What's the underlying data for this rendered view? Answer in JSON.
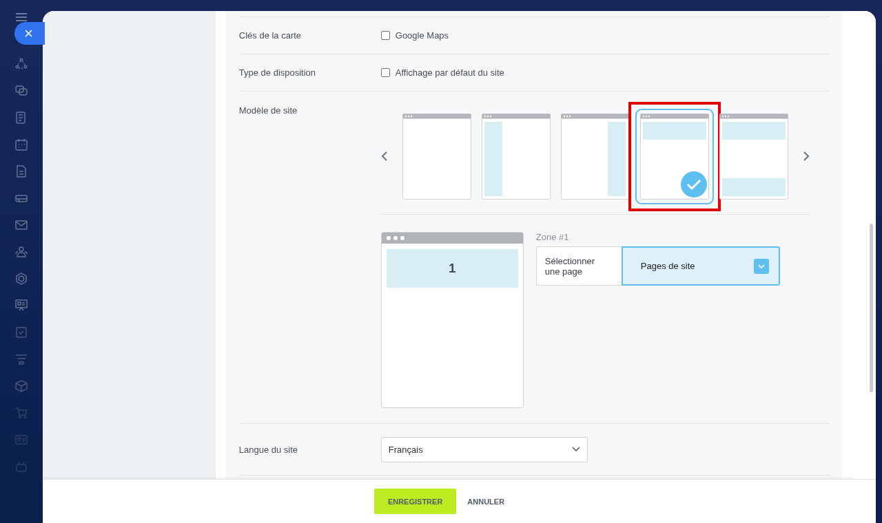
{
  "form": {
    "rows": [
      {
        "kind": "checkbox",
        "label": "Clés de la carte",
        "option": "Google Maps",
        "checked": false
      },
      {
        "kind": "checkbox",
        "label": "Type de disposition",
        "option": "Affichage par défaut du site",
        "checked": false
      },
      {
        "kind": "templates",
        "label": "Modèle de site",
        "templates": [
          {
            "kind": "blank",
            "selected": false
          },
          {
            "kind": "left",
            "selected": false
          },
          {
            "kind": "right",
            "selected": false
          },
          {
            "kind": "top",
            "selected": true
          },
          {
            "kind": "banded",
            "selected": false
          }
        ],
        "preview": {
          "zone_number": "1"
        },
        "zone": {
          "label": "Zone #1",
          "prompt": "Sélectionner une page",
          "value": "Pages de site"
        }
      },
      {
        "kind": "select",
        "label": "Langue du site",
        "value": "Français"
      }
    ]
  },
  "footer": {
    "buttons": [
      {
        "label": "ENREGISTRER",
        "primary": true
      },
      {
        "label": "ANNULER",
        "primary": false
      }
    ]
  }
}
